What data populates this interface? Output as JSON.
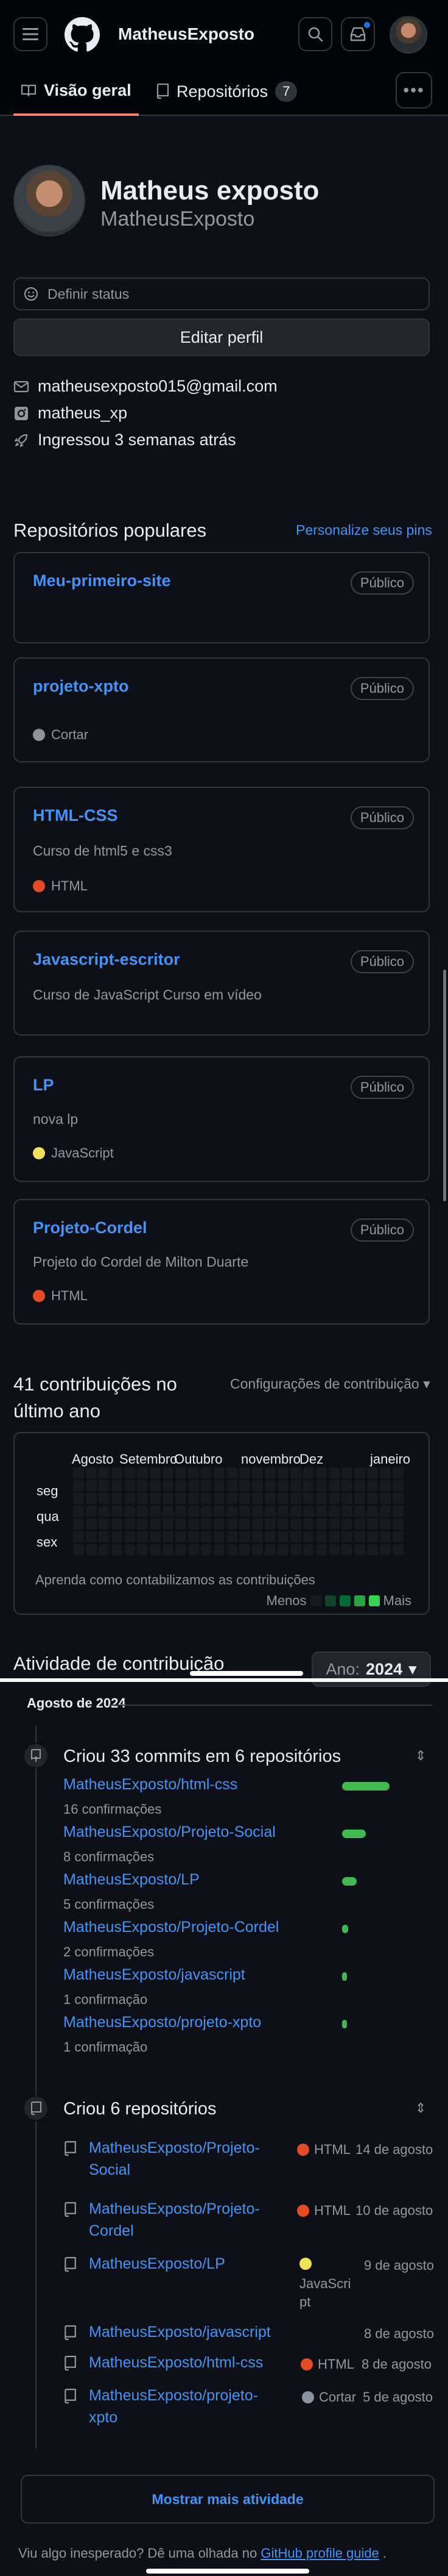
{
  "header": {
    "owner": "MatheusExposto"
  },
  "tabs": [
    {
      "label": "Visão geral"
    },
    {
      "label": "Repositórios",
      "count": "7"
    }
  ],
  "profile": {
    "full_name": "Matheus exposto",
    "login": "MatheusExposto",
    "status_placeholder": "Definir status",
    "edit_label": "Editar perfil",
    "email": "matheusexposto015@gmail.com",
    "instagram": "matheus_xp",
    "joined": "Ingressou 3 semanas atrás"
  },
  "popular": {
    "title": "Repositórios populares",
    "customize": "Personalize seus pins",
    "repos": [
      {
        "name": "Meu-primeiro-site",
        "visibility": "Público",
        "description": "",
        "language": "",
        "lang_color": ""
      },
      {
        "name": "projeto-xpto",
        "visibility": "Público",
        "description": "",
        "language": "Cortar",
        "lang_color": "#8b949e"
      },
      {
        "name": "HTML-CSS",
        "visibility": "Público",
        "description": "Curso de html5 e css3",
        "language": "HTML",
        "lang_color": "#e34c26"
      },
      {
        "name": "Javascript-escritor",
        "visibility": "Público",
        "description": "Curso de JavaScript Curso em vídeo",
        "language": "",
        "lang_color": ""
      },
      {
        "name": "LP",
        "visibility": "Público",
        "description": "nova lp",
        "language": "JavaScript",
        "lang_color": "#f1e05a"
      },
      {
        "name": "Projeto-Cordel",
        "visibility": "Público",
        "description": "Projeto do Cordel de Milton Duarte",
        "language": "HTML",
        "lang_color": "#e34c26"
      }
    ]
  },
  "contributions": {
    "title": "41 contribuições no último ano",
    "settings": "Configurações de contribuição",
    "months": [
      "Agosto",
      "Setembro",
      "Outubro",
      "novembro",
      "Dez",
      "janeiro"
    ],
    "days": [
      "seg",
      "qua",
      "sex"
    ],
    "help": "Aprenda como contabilizamos as contribuições",
    "less": "Menos",
    "more": "Mais",
    "legend_colors": [
      "#161b22",
      "#0e4429",
      "#006d32",
      "#26a641",
      "#39d353"
    ]
  },
  "activity": {
    "title": "Atividade de contribuição",
    "year_prefix": "Ano:",
    "year": "2024",
    "month_label": "Agosto de 2024",
    "commits": {
      "heading": "Criou 33 commits em 6 repositórios",
      "items": [
        {
          "repo": "MatheusExposto/html-css",
          "count": "16 confirmações",
          "share": 16
        },
        {
          "repo": "MatheusExposto/Projeto-Social",
          "count": "8 confirmações",
          "share": 8
        },
        {
          "repo": "MatheusExposto/LP",
          "count": "5 confirmações",
          "share": 5
        },
        {
          "repo": "MatheusExposto/Projeto-Cordel",
          "count": "2 confirmações",
          "share": 2
        },
        {
          "repo": "MatheusExposto/javascript",
          "count": "1 confirmação",
          "share": 1
        },
        {
          "repo": "MatheusExposto/projeto-xpto",
          "count": "1 confirmação",
          "share": 1
        }
      ]
    },
    "created": {
      "heading": "Criou 6 repositórios",
      "items": [
        {
          "repo": "MatheusExposto/Projeto-Social",
          "language": "HTML",
          "lang_color": "#e34c26",
          "date": "14 de agosto"
        },
        {
          "repo": "MatheusExposto/Projeto-Cordel",
          "language": "HTML",
          "lang_color": "#e34c26",
          "date": "10 de agosto"
        },
        {
          "repo": "MatheusExposto/LP",
          "language": "JavaScript",
          "lang_color": "#f1e05a",
          "date": "9 de agosto"
        },
        {
          "repo": "MatheusExposto/javascript",
          "language": "",
          "lang_color": "",
          "date": "8 de agosto"
        },
        {
          "repo": "MatheusExposto/html-css",
          "language": "HTML",
          "lang_color": "#e34c26",
          "date": "8 de agosto"
        },
        {
          "repo": "MatheusExposto/projeto-xpto",
          "language": "Cortar",
          "lang_color": "#8b949e",
          "date": "5 de agosto"
        }
      ]
    },
    "show_more": "Mostrar mais atividade"
  },
  "footer": {
    "prefix": "Viu algo inesperado? Dê uma olhada no",
    "link": "GitHub profile guide",
    "suffix": "."
  }
}
